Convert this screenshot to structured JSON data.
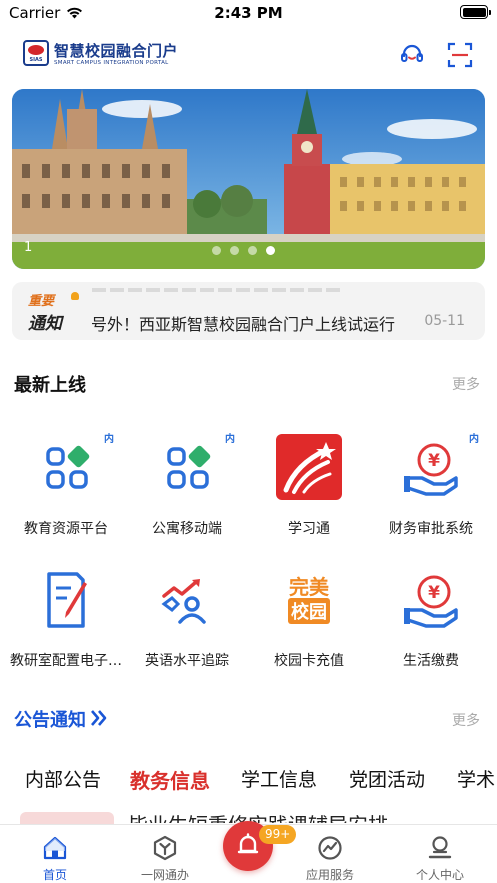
{
  "status_bar": {
    "carrier": "Carrier",
    "time": "2:43 PM"
  },
  "header": {
    "logo_text": "SIAS",
    "brand_cn": "智慧校园融合门户",
    "brand_en": "SMART CAMPUS INTEGRATION PORTAL"
  },
  "banner": {
    "index": "1",
    "dot_count": 4,
    "active_dot": 4
  },
  "notice": {
    "badge_top": "重要",
    "badge_bottom": "通知",
    "text": "号外！西亚斯智慧校园融合门户上线试运行",
    "date": "05-11"
  },
  "new_apps": {
    "title": "最新上线",
    "more": "更多",
    "items": [
      {
        "label": "教育资源平台",
        "icon": "app-grid-icon",
        "badge": "内"
      },
      {
        "label": "公寓移动端",
        "icon": "app-grid-icon",
        "badge": "内"
      },
      {
        "label": "学习通",
        "icon": "xuexitong-logo-icon",
        "badge": ""
      },
      {
        "label": "财务审批系统",
        "icon": "yuan-hand-icon",
        "badge": "内"
      },
      {
        "label": "教研室配置电子档案",
        "icon": "document-edit-icon",
        "badge": ""
      },
      {
        "label": "英语水平追踪",
        "icon": "person-trend-icon",
        "badge": ""
      },
      {
        "label": "校园卡充值",
        "icon": "wanmei-xiaoyuan-logo-icon",
        "badge": ""
      },
      {
        "label": "生活缴费",
        "icon": "yuan-hand-icon",
        "badge": ""
      }
    ]
  },
  "announcements": {
    "title": "公告通知",
    "more": "更多",
    "tabs": [
      "内部公告",
      "教务信息",
      "学工信息",
      "党团活动",
      "学术"
    ],
    "active_tab": 1,
    "first_item_title": "毕业生短重修实践课辅导安排"
  },
  "tabbar": {
    "items": [
      {
        "label": "首页",
        "icon": "home-icon",
        "active": true
      },
      {
        "label": "一网通办",
        "icon": "hexagon-y-icon",
        "active": false
      },
      {
        "label": "应用服务",
        "icon": "trend-circle-icon",
        "active": false
      },
      {
        "label": "个人中心",
        "icon": "person-icon",
        "active": false
      }
    ],
    "center_badge": "99+",
    "center_icon": "bell-icon"
  },
  "colors": {
    "brand_blue": "#1a3c8c",
    "accent_blue": "#1a56d6",
    "accent_red": "#d9302c",
    "badge_orange": "#f5a623"
  }
}
